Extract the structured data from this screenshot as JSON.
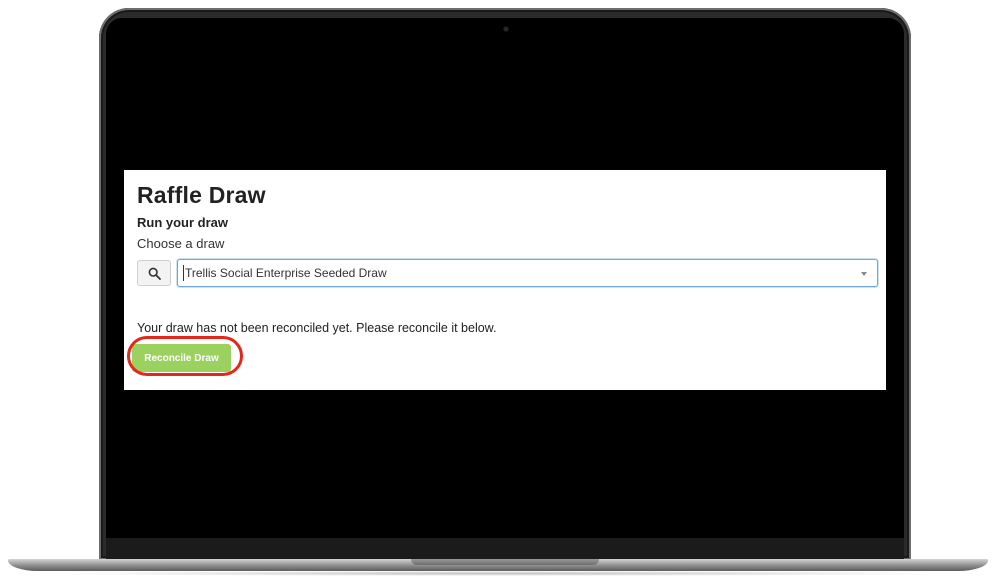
{
  "app": {
    "title": "Raffle Draw",
    "section_title": "Run your draw",
    "field_label": "Choose a draw"
  },
  "draw_select": {
    "selected_value": "Trellis Social Enterprise Seeded Draw",
    "search_icon": "search-icon",
    "dropdown_icon": "chevron-down-icon"
  },
  "status": {
    "message": "Your draw has not been reconciled yet. Please reconcile it below."
  },
  "actions": {
    "reconcile_label": "Reconcile Draw"
  },
  "colors": {
    "accent_button": "#9bd15e",
    "highlight_ring": "#e4271b",
    "focus_border": "#6fa8dc",
    "screen_background": "#000000"
  }
}
